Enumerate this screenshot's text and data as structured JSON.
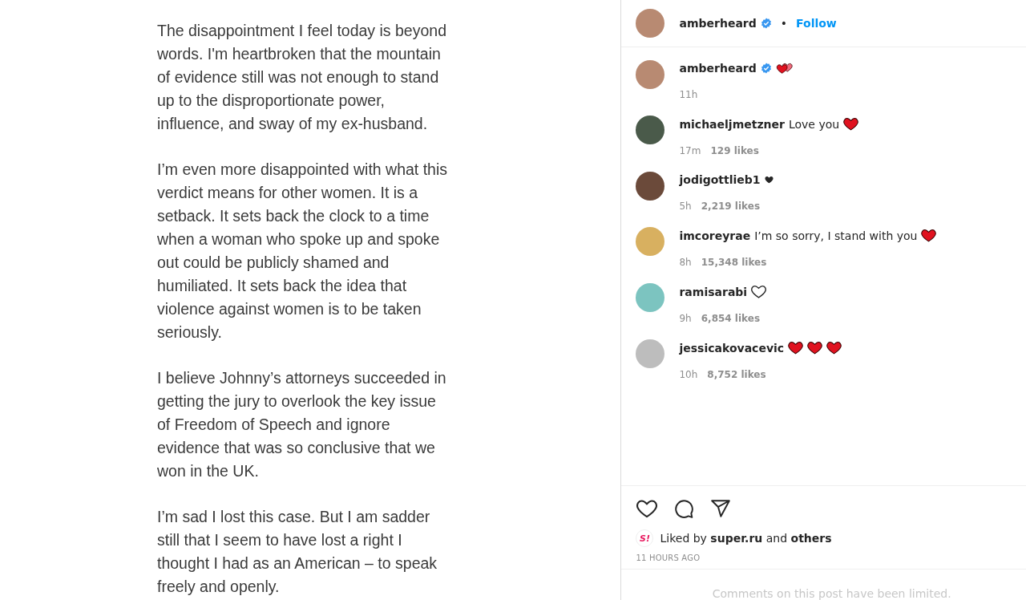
{
  "post_text": {
    "paragraphs": [
      "The disappointment I feel today is beyond words. I'm heartbroken that the mountain of evidence still was not enough to stand up to the disproportionate power, influence, and sway of my ex-husband.",
      "I’m even more disappointed with what this verdict means for other women. It is a setback. It sets back the clock to a time when a woman who spoke up and spoke out could be publicly shamed and humiliated. It sets back the idea that violence against women is to be taken seriously.",
      "I believe Johnny’s attorneys succeeded in getting the jury to overlook the key issue of Freedom of Speech and ignore evidence that was so conclusive that we won in the UK.",
      "I’m sad I lost this case. But I am sadder still that I seem to have lost a right I thought I had as an American – to speak freely and openly."
    ]
  },
  "header": {
    "username": "amberheard",
    "verified": true,
    "separator": "•",
    "follow": "Follow"
  },
  "comments": [
    {
      "username": "amberheard",
      "verified": true,
      "emojis": [
        {
          "kind": "two-hearts"
        }
      ],
      "time": "11h"
    },
    {
      "username": "michaeljmetzner",
      "verified": false,
      "text": "Love you",
      "emojis": [
        {
          "kind": "red-heart"
        }
      ],
      "time": "17m",
      "likes": "129 likes"
    },
    {
      "username": "jodigottlieb1",
      "verified": false,
      "emojis": [
        {
          "kind": "black-heart"
        }
      ],
      "time": "5h",
      "likes": "2,219 likes"
    },
    {
      "username": "imcoreyrae",
      "verified": false,
      "text": "I’m so sorry, I stand with you",
      "emojis": [
        {
          "kind": "red-heart"
        }
      ],
      "time": "8h",
      "likes": "15,348 likes"
    },
    {
      "username": "ramisarabi",
      "verified": false,
      "emojis": [
        {
          "kind": "outline-heart"
        }
      ],
      "time": "9h",
      "likes": "6,854 likes"
    },
    {
      "username": "jessicakovacevic",
      "verified": false,
      "emojis": [
        {
          "kind": "red-heart"
        },
        {
          "kind": "red-heart"
        },
        {
          "kind": "red-heart"
        }
      ],
      "time": "10h",
      "likes": "8,752 likes"
    }
  ],
  "likes": {
    "badge": "S!",
    "prefix": "Liked by",
    "user": "super.ru",
    "middle": "and",
    "others": "others"
  },
  "timestamp": "11 HOURS AGO",
  "comments_notice": "Comments on this post have been limited."
}
